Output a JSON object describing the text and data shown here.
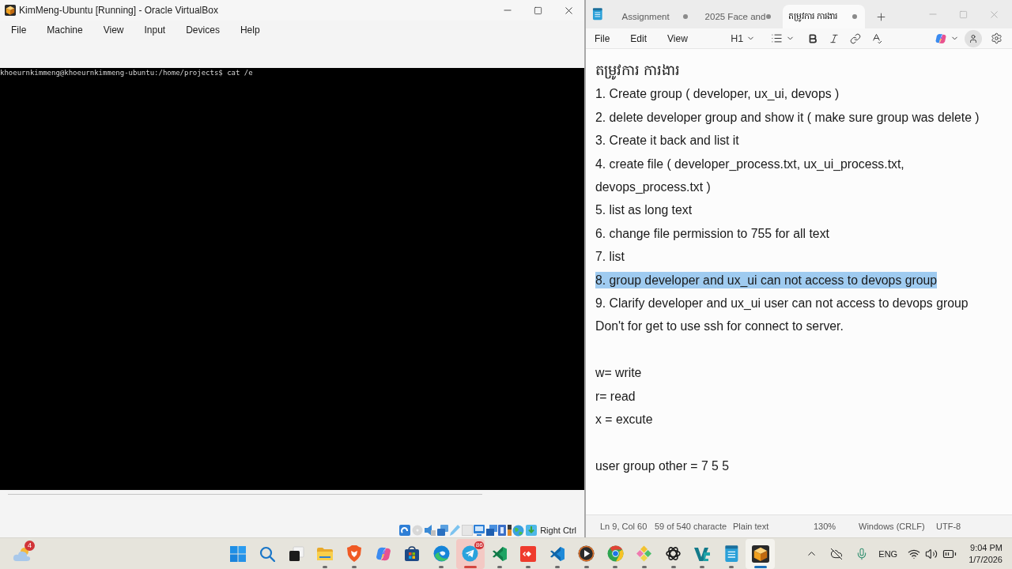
{
  "virtualbox": {
    "title": "KimMeng-Ubuntu [Running] - Oracle VirtualBox",
    "menu": [
      "File",
      "Machine",
      "View",
      "Input",
      "Devices",
      "Help"
    ],
    "terminal": {
      "lines": [
        "khoeurnkimmeng@khoeurnkimmeng-ubuntu:/home/projects$ cat /e"
      ]
    },
    "status_bar": {
      "host_key": "Right Ctrl"
    }
  },
  "notepad": {
    "tabs": [
      {
        "label": "Assignment",
        "selected": false,
        "modified": true
      },
      {
        "label": "2025 Face and",
        "selected": false,
        "modified": true
      },
      {
        "label": "តម្រូវការ ការងារ",
        "selected": true,
        "modified": true
      }
    ],
    "menu": [
      "File",
      "Edit",
      "View"
    ],
    "toolbar": {
      "heading_style": "H1"
    },
    "document": {
      "blocks": [
        [
          {
            "kind": "heading",
            "text": "តម្រូវការ ការងារ",
            "selected": false
          },
          {
            "kind": "text",
            "text": "1. Create group ( developer, ux_ui, devops )",
            "selected": false
          },
          {
            "kind": "text",
            "text": "2. delete developer group and show it ( make sure group was delete )",
            "selected": false
          },
          {
            "kind": "text",
            "text": "3. Create it back and list it",
            "selected": false
          },
          {
            "kind": "text",
            "text": "4. create file ( developer_process.txt, ux_ui_process.txt, devops_process.txt )",
            "selected": false
          },
          {
            "kind": "text",
            "text": "5. list as long text",
            "selected": false
          },
          {
            "kind": "text",
            "text": "6. change file permission to 755 for all text",
            "selected": false
          },
          {
            "kind": "text",
            "text": "7. list",
            "selected": false
          },
          {
            "kind": "text",
            "text": "8. group developer and ux_ui can not access to devops group",
            "selected": true
          },
          {
            "kind": "text",
            "text": "9. Clarify developer and ux_ui user can not access to devops group",
            "selected": false
          },
          {
            "kind": "text",
            "text": "Don't for get to use ssh for connect to server.",
            "selected": false
          }
        ],
        [
          {
            "kind": "text",
            "text": "w= write",
            "selected": false
          },
          {
            "kind": "text",
            "text": "r= read",
            "selected": false
          },
          {
            "kind": "text",
            "text": "x = excute",
            "selected": false
          }
        ],
        [
          {
            "kind": "text",
            "text": "user group other = 7 5 5",
            "selected": false
          }
        ]
      ]
    },
    "status_bar": {
      "position": "Ln 9, Col 60",
      "characters": "59 of 540 characte",
      "format": "Plain text",
      "zoom": "130%",
      "line_endings": "Windows (CRLF)",
      "encoding": "UTF-8"
    }
  },
  "taskbar": {
    "weather_badge": "4",
    "apps": [
      {
        "kind": "windows",
        "running": false,
        "selected": false,
        "flashing": false
      },
      {
        "kind": "search",
        "running": false,
        "selected": false,
        "flashing": false
      },
      {
        "kind": "taskview",
        "running": false,
        "selected": false,
        "flashing": false
      },
      {
        "kind": "folder",
        "running": true,
        "selected": false,
        "flashing": false
      },
      {
        "kind": "shield",
        "running": true,
        "selected": false,
        "flashing": false
      },
      {
        "kind": "swirl",
        "running": false,
        "selected": false,
        "flashing": false
      },
      {
        "kind": "bag",
        "running": false,
        "selected": false,
        "flashing": false
      },
      {
        "kind": "wave",
        "running": true,
        "selected": false,
        "flashing": false
      },
      {
        "kind": "plane",
        "running": true,
        "selected": false,
        "flashing": true,
        "badge": "86"
      },
      {
        "kind": "ribbonalt",
        "running": true,
        "selected": false,
        "flashing": false
      },
      {
        "kind": "diamonds",
        "running": true,
        "selected": false,
        "flashing": false
      },
      {
        "kind": "ribbon",
        "running": true,
        "selected": false,
        "flashing": false
      },
      {
        "kind": "play",
        "running": true,
        "selected": false,
        "flashing": false
      },
      {
        "kind": "ball",
        "running": true,
        "selected": false,
        "flashing": false
      },
      {
        "kind": "tiles",
        "running": true,
        "selected": false,
        "flashing": false
      },
      {
        "kind": "knot",
        "running": true,
        "selected": false,
        "flashing": false
      },
      {
        "kind": "vee",
        "running": true,
        "selected": false,
        "flashing": false
      },
      {
        "kind": "notepad",
        "running": true,
        "selected": false,
        "flashing": false
      },
      {
        "kind": "cube",
        "running": true,
        "selected": true,
        "flashing": false
      }
    ],
    "tray": {
      "language": "ENG"
    },
    "clock": {
      "time": "9:04 PM",
      "date": "1/7/2026"
    }
  }
}
